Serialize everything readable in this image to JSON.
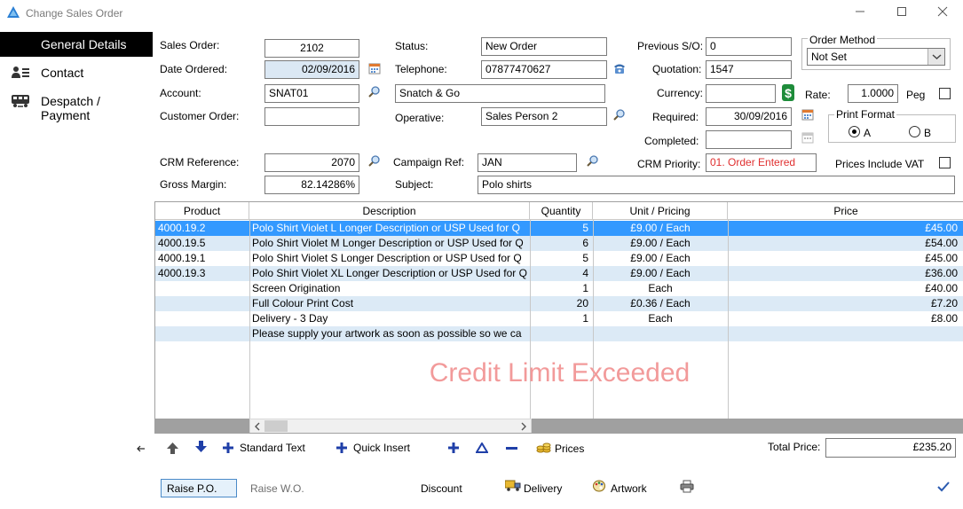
{
  "window": {
    "title": "Change Sales Order"
  },
  "nav": {
    "items": [
      {
        "label": "General Details"
      },
      {
        "label": "Contact"
      },
      {
        "label": "Despatch / Payment"
      }
    ]
  },
  "form": {
    "sales_order": {
      "label": "Sales Order:",
      "value": "2102"
    },
    "date_ordered": {
      "label": "Date Ordered:",
      "value": "02/09/2016"
    },
    "account": {
      "label": "Account:",
      "value": "SNAT01"
    },
    "customer_order": {
      "label": "Customer Order:",
      "value": ""
    },
    "status": {
      "label": "Status:",
      "value": "New Order"
    },
    "telephone": {
      "label": "Telephone:",
      "value": "07877470627"
    },
    "account_name": {
      "value": "Snatch & Go"
    },
    "operative": {
      "label": "Operative:",
      "value": "Sales Person 2"
    },
    "previous_so": {
      "label": "Previous S/O:",
      "value": "0"
    },
    "quotation": {
      "label": "Quotation:",
      "value": "1547"
    },
    "currency": {
      "label": "Currency:",
      "value": ""
    },
    "required": {
      "label": "Required:",
      "value": "30/09/2016"
    },
    "completed": {
      "label": "Completed:",
      "value": ""
    },
    "order_method": {
      "label": "Order Method",
      "value": "Not Set"
    },
    "rate": {
      "label": "Rate:",
      "value": "1.0000"
    },
    "peg": {
      "label": "Peg"
    },
    "print_format": {
      "label": "Print Format",
      "options": [
        "A",
        "B"
      ],
      "selected": "A"
    },
    "crm_reference": {
      "label": "CRM Reference:",
      "value": "2070"
    },
    "campaign_ref": {
      "label": "Campaign Ref:",
      "value": "JAN"
    },
    "crm_priority": {
      "label": "CRM Priority:",
      "value": "01. Order Entered"
    },
    "prices_include_vat": {
      "label": "Prices Include VAT"
    },
    "gross_margin": {
      "label": "Gross Margin:",
      "value": "82.14286%"
    },
    "subject": {
      "label": "Subject:",
      "value": "Polo shirts"
    }
  },
  "grid": {
    "columns": [
      "Product",
      "Description",
      "Quantity",
      "Unit / Pricing",
      "Price"
    ],
    "rows": [
      {
        "product": "4000.19.2",
        "description": "Polo Shirt Violet L  Longer Description or USP  Used for Q",
        "quantity": "5",
        "unit": "£9.00 / Each",
        "price": "£45.00"
      },
      {
        "product": "4000.19.5",
        "description": "Polo Shirt Violet M  Longer Description or USP  Used for Q",
        "quantity": "6",
        "unit": "£9.00 / Each",
        "price": "£54.00"
      },
      {
        "product": "4000.19.1",
        "description": "Polo Shirt Violet S  Longer Description or USP  Used for Q",
        "quantity": "5",
        "unit": "£9.00 / Each",
        "price": "£45.00"
      },
      {
        "product": "4000.19.3",
        "description": "Polo Shirt Violet XL  Longer Description or USP  Used for Q",
        "quantity": "4",
        "unit": "£9.00 / Each",
        "price": "£36.00"
      },
      {
        "product": "",
        "description": "Screen Origination",
        "quantity": "1",
        "unit": "Each",
        "price": "£40.00"
      },
      {
        "product": "",
        "description": "Full Colour Print Cost",
        "quantity": "20",
        "unit": "£0.36 / Each",
        "price": "£7.20"
      },
      {
        "product": "",
        "description": "Delivery - 3 Day",
        "quantity": "1",
        "unit": "Each",
        "price": "£8.00"
      },
      {
        "product": "",
        "description": " Please supply your artwork as soon as possible so we ca",
        "quantity": "",
        "unit": "",
        "price": ""
      }
    ],
    "watermark": "Credit Limit Exceeded"
  },
  "toolbar": {
    "standard_text": "Standard Text",
    "quick_insert": "Quick Insert",
    "prices": "Prices",
    "total_label": "Total Price:",
    "total_value": "£235.20"
  },
  "bottom": {
    "raise_po": "Raise P.O.",
    "raise_wo": "Raise W.O.",
    "discount": "Discount",
    "delivery": "Delivery",
    "artwork": "Artwork"
  },
  "colors": {
    "selected_row": "#3399ff",
    "alt_row": "#dceaf6",
    "watermark": "#f29a9a",
    "priority_text": "#e03030"
  }
}
